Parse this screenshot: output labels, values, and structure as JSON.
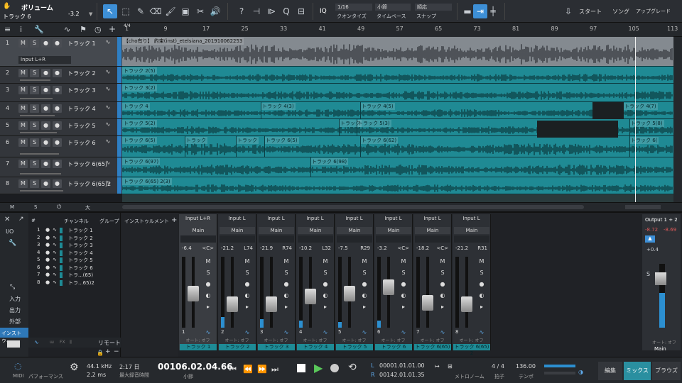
{
  "toolbar": {
    "volume_label": "ボリューム",
    "track_label": "トラック 6",
    "volume_value": "-3.2",
    "quantize": {
      "value": "1/16",
      "label": "クオンタイズ"
    },
    "timebase": {
      "value": "小節",
      "label": "タイムベース"
    },
    "snap": {
      "value": "順応",
      "label": "スナップ"
    },
    "iq_label": "IQ",
    "start_label": "スタート",
    "song_label": "ソング",
    "upgrade_label": "アップグレード"
  },
  "ruler": {
    "marks": [
      "1",
      "9",
      "17",
      "25",
      "33",
      "41",
      "49",
      "57",
      "65",
      "73",
      "81",
      "89",
      "97",
      "105",
      "113"
    ],
    "sig": "4/4"
  },
  "tracks": [
    {
      "num": "1",
      "name": "トラック 1",
      "input": "Input L+R",
      "clips": [
        {
          "label": "【cho有り】 約束(inst)_etelsiana_201910062253",
          "start": 0
        }
      ]
    },
    {
      "num": "2",
      "name": "トラック 2",
      "clips": [
        {
          "label": "トラック 2(5)",
          "start": 0
        }
      ]
    },
    {
      "num": "3",
      "name": "トラック 3",
      "clips": [
        {
          "label": "トラック 3(2)",
          "start": 0
        }
      ]
    },
    {
      "num": "4",
      "name": "トラック 4",
      "clips": [
        {
          "label": "トラック 4",
          "start": 0
        },
        {
          "label": "トラック 4(3)",
          "start": 195
        },
        {
          "label": "トラック 4(5)",
          "start": 335
        },
        {
          "label": "トラック 4(7)",
          "start": 705
        }
      ]
    },
    {
      "num": "5",
      "name": "トラック 5",
      "clips": [
        {
          "label": "トラック 5(2)",
          "start": 0
        },
        {
          "label": "トラック",
          "start": 305
        },
        {
          "label": "トラック 5(3)",
          "start": 330
        },
        {
          "label": "トラック 5(8)",
          "start": 714
        }
      ]
    },
    {
      "num": "6",
      "name": "トラック 6",
      "clips": [
        {
          "label": "トラック 6(5)",
          "start": 0
        },
        {
          "label": "トラック",
          "start": 88
        },
        {
          "label": "トラック",
          "start": 160
        },
        {
          "label": "トラック 6(5)",
          "start": 200
        },
        {
          "label": "トラック 6(62)",
          "start": 335
        },
        {
          "label": "トラック 6(",
          "start": 714
        }
      ]
    },
    {
      "num": "7",
      "name": "トラック 6(65)",
      "clips": [
        {
          "label": "トラック 6(97)",
          "start": 0
        },
        {
          "label": "トラック 6(98)",
          "start": 265
        }
      ]
    },
    {
      "num": "8",
      "name": "トラック 6(65)2",
      "clips": [
        {
          "label": "トラック 6(65) 2(3)",
          "start": 0
        }
      ]
    }
  ],
  "browser": {
    "tabs": {
      "channel": "チャンネル",
      "group": "グループ",
      "instruments": "インストゥルメント"
    },
    "list": [
      "トラック 1",
      "トラック 2",
      "トラック 3",
      "トラック 4",
      "トラック 5",
      "トラック 6",
      "トラ...(65)",
      "トラ...65)2"
    ],
    "side": [
      "入力",
      "出力",
      "外部",
      "インストゥ..."
    ],
    "remote": "リモート",
    "io": "I/O"
  },
  "mixer": {
    "channels": [
      {
        "input": "Input L+R",
        "route": "Main",
        "vol": "-6.4",
        "pan": "<C>",
        "num": "1",
        "name": "トラック 1",
        "level": 0.55,
        "meter": 0.0
      },
      {
        "input": "Input L",
        "route": "Main",
        "vol": "-21.2",
        "pan": "L74",
        "num": "2",
        "name": "トラック 2",
        "level": 0.38,
        "meter": 0.15
      },
      {
        "input": "Input L",
        "route": "Main",
        "vol": "-21.9",
        "pan": "R74",
        "num": "3",
        "name": "トラック 3",
        "level": 0.38,
        "meter": 0.12
      },
      {
        "input": "Input L",
        "route": "Main",
        "vol": "-10.2",
        "pan": "L32",
        "num": "4",
        "name": "トラック 4",
        "level": 0.5,
        "meter": 0.1
      },
      {
        "input": "Input L",
        "route": "Main",
        "vol": "-7.5",
        "pan": "R29",
        "num": "5",
        "name": "トラック 5",
        "level": 0.55,
        "meter": 0.08
      },
      {
        "input": "Input L",
        "route": "Main",
        "vol": "-3.2",
        "pan": "<C>",
        "num": "6",
        "name": "トラック 6",
        "level": 0.65,
        "meter": 0.1
      },
      {
        "input": "Input L",
        "route": "Main",
        "vol": "-18.2",
        "pan": "<C>",
        "num": "7",
        "name": "トラック 6(65)",
        "level": 0.4,
        "meter": 0.0
      },
      {
        "input": "Input L",
        "route": "Main",
        "vol": "-21.2",
        "pan": "R31",
        "num": "8",
        "name": "トラック 6(65) 2",
        "level": 0.38,
        "meter": 0.0
      }
    ],
    "auto": "オート: オフ",
    "output": {
      "name": "Output 1 + 2",
      "l": "-8.72",
      "r": "-8.69",
      "vol": "+0.4",
      "route": "Main"
    }
  },
  "transport": {
    "midi": "MIDI",
    "performance": "パフォーマンス",
    "rate": "44.1 kHz",
    "latency": "2.2 ms",
    "rec_time": "2:17 日",
    "rec_label": "最大録音時間",
    "position": "00106.02.04.66",
    "pos_label": "小節",
    "loop_l": "00001.01.01.00",
    "loop_r": "00142.01.01.35",
    "metronome": "メトロノーム",
    "sig": "4 / 4",
    "sig_label": "拍子",
    "tempo": "136.00",
    "tempo_label": "テンポ",
    "edit": "編集",
    "mix": "ミックス",
    "browse": "ブラウズ"
  }
}
